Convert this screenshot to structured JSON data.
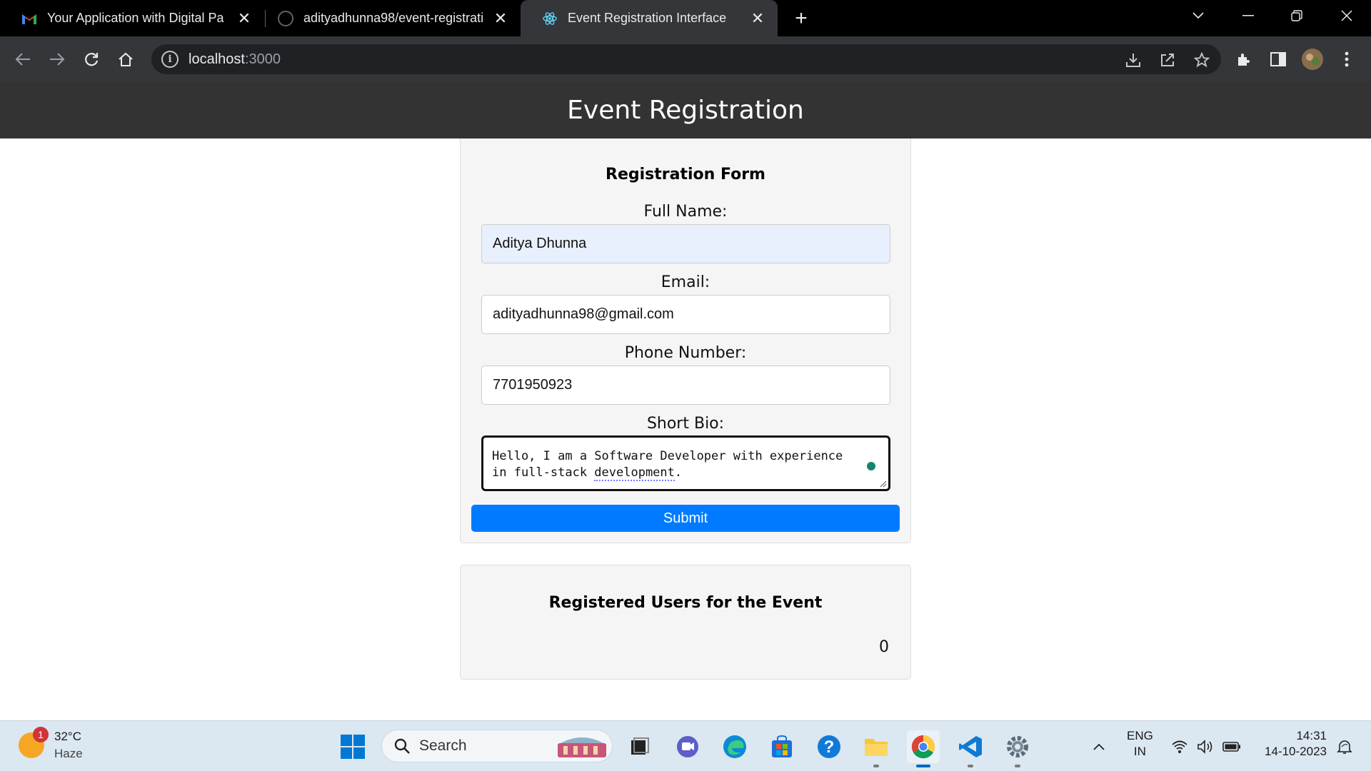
{
  "browser": {
    "tabs": [
      {
        "title": "Your Application with Digital Pa",
        "icon": "gmail-icon"
      },
      {
        "title": "adityadhunna98/event-registrati",
        "icon": "github-icon"
      },
      {
        "title": "Event Registration Interface",
        "icon": "react-icon"
      }
    ],
    "address": {
      "host": "localhost",
      "port": ":3000"
    }
  },
  "page": {
    "header": "Event Registration",
    "form": {
      "title": "Registration Form",
      "full_name": {
        "label": "Full Name:",
        "value": "Aditya Dhunna"
      },
      "email": {
        "label": "Email:",
        "value": "adityadhunna98@gmail.com"
      },
      "phone": {
        "label": "Phone Number:",
        "value": "7701950923"
      },
      "bio": {
        "label": "Short Bio:",
        "line1": "Hello, I am a Software Developer with experience",
        "line2_prefix": "in full-stack ",
        "line2_flagged": "development",
        "line2_suffix": "."
      },
      "submit_label": "Submit"
    },
    "registered": {
      "title": "Registered Users for the Event",
      "count": "0"
    }
  },
  "taskbar": {
    "weather": {
      "temp": "32°C",
      "condition": "Haze",
      "badge": "1"
    },
    "search_label": "Search",
    "lang": {
      "line1": "ENG",
      "line2": "IN"
    },
    "time": "14:31",
    "date": "14-10-2023"
  }
}
